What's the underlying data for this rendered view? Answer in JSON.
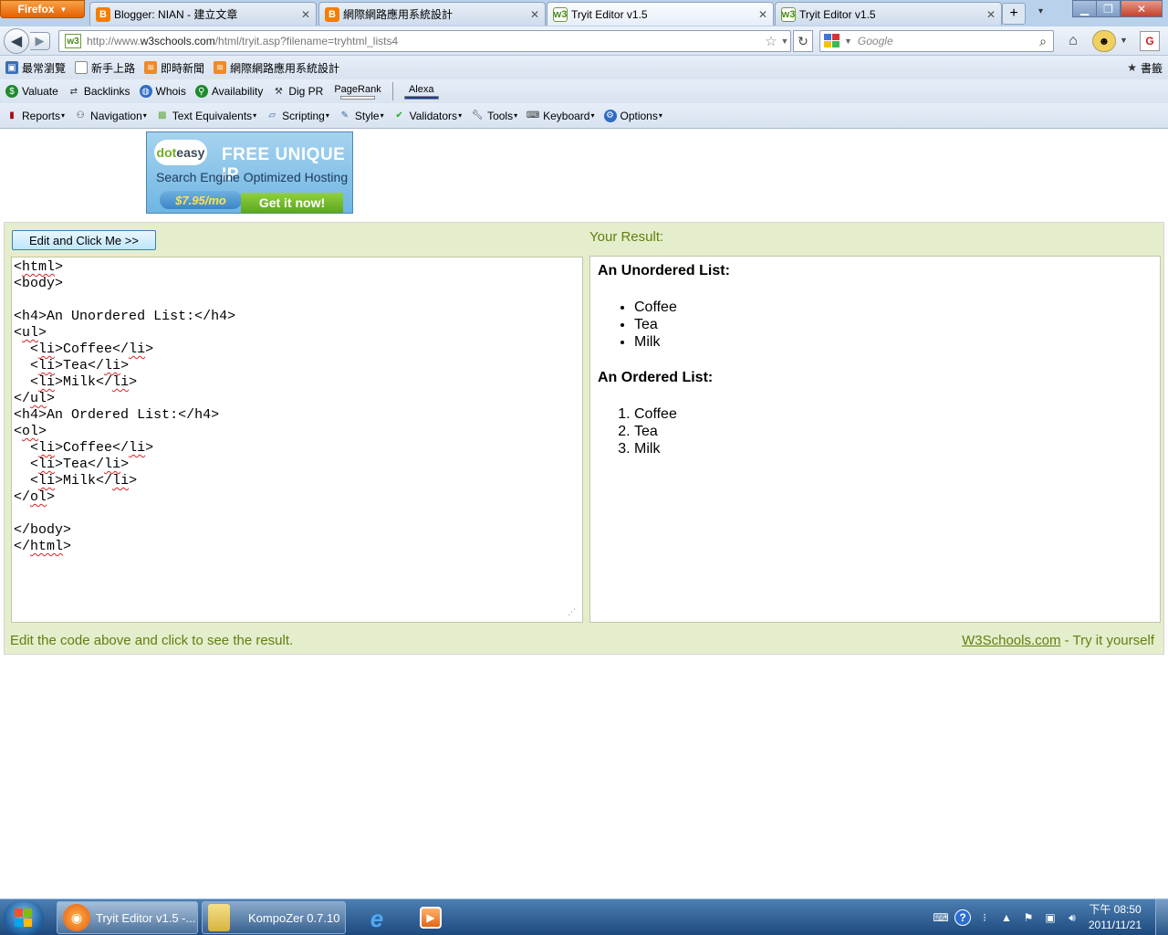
{
  "browser": {
    "menu_label": "Firefox",
    "tabs": [
      {
        "label": "Blogger: NIAN - 建立文章",
        "icon": "blogger-icon"
      },
      {
        "label": "網際網路應用系統設計",
        "icon": "blogger-icon"
      },
      {
        "label": "Tryit Editor v1.5",
        "icon": "w3schools-icon",
        "active": true
      },
      {
        "label": "Tryit Editor v1.5",
        "icon": "w3schools-icon"
      }
    ],
    "url_prefix": "http://www.",
    "url_domain": "w3schools.com",
    "url_path": "/html/tryit.asp?filename=tryhtml_lists4",
    "search_placeholder": "Google"
  },
  "bookmarks": [
    {
      "label": "最常瀏覽",
      "icon": "most-visited-icon"
    },
    {
      "label": "新手上路",
      "icon": "page-icon"
    },
    {
      "label": "即時新聞",
      "icon": "rss-icon"
    },
    {
      "label": "網際網路應用系統設計",
      "icon": "rss-icon"
    }
  ],
  "bookmarks_right": "書籤",
  "seoquake": {
    "items": [
      {
        "label": "Valuate",
        "icon": "dollar-icon"
      },
      {
        "label": "Backlinks",
        "icon": "arrows-icon"
      },
      {
        "label": "Whois",
        "icon": "globe-icon"
      },
      {
        "label": "Availability",
        "icon": "magnifier-icon"
      },
      {
        "label": "Dig PR",
        "icon": "dig-icon"
      }
    ],
    "pagerank_label": "PageRank",
    "alexa_label": "Alexa"
  },
  "webdev": [
    {
      "label": "Reports",
      "icon": "reports-icon"
    },
    {
      "label": "Navigation",
      "icon": "navigation-icon"
    },
    {
      "label": "Text Equivalents",
      "icon": "text-equivalents-icon"
    },
    {
      "label": "Scripting",
      "icon": "scripting-icon"
    },
    {
      "label": "Style",
      "icon": "style-icon"
    },
    {
      "label": "Validators",
      "icon": "validators-icon"
    },
    {
      "label": "Tools",
      "icon": "tools-icon"
    },
    {
      "label": "Keyboard",
      "icon": "keyboard-icon"
    },
    {
      "label": "Options",
      "icon": "options-icon"
    }
  ],
  "ad": {
    "logo": "dot",
    "logo2": "easy",
    "headline": "FREE UNIQUE IP",
    "subline": "Search Engine Optimized Hosting",
    "price": "$7.95/mo",
    "cta": "Get it now!"
  },
  "tryit": {
    "submit_label": "Edit and Click Me >>",
    "result_label": "Your Result:",
    "code_lines": [
      "<html>",
      "<body>",
      "",
      "<h4>An Unordered List:</h4>",
      "<ul>",
      "  <li>Coffee</li>",
      "  <li>Tea</li>",
      "  <li>Milk</li>",
      "</ul>",
      "<h4>An Ordered List:</h4>",
      "<ol>",
      "  <li>Coffee</li>",
      "  <li>Tea</li>",
      "  <li>Milk</li>",
      "</ol>",
      "",
      "</body>",
      "</html>"
    ],
    "result": {
      "unordered_heading": "An Unordered List:",
      "unordered_items": [
        "Coffee",
        "Tea",
        "Milk"
      ],
      "ordered_heading": "An Ordered List:",
      "ordered_items": [
        "Coffee",
        "Tea",
        "Milk"
      ]
    },
    "footer_left": "Edit the code above and click to see the result.",
    "footer_link": "W3Schools.com",
    "footer_suffix": " - Try it yourself"
  },
  "taskbar": {
    "tasks": [
      {
        "label": "Tryit Editor v1.5 -...",
        "icon": "firefox-icon"
      },
      {
        "label": "KompoZer 0.7.10",
        "icon": "folder-icon"
      }
    ],
    "clock_time": "下午 08:50",
    "clock_date": "2011/11/21"
  },
  "colors": {
    "tryit_bg": "#e5eecc",
    "tryit_text": "#617f10",
    "taskbar": "#1d4a7e"
  }
}
